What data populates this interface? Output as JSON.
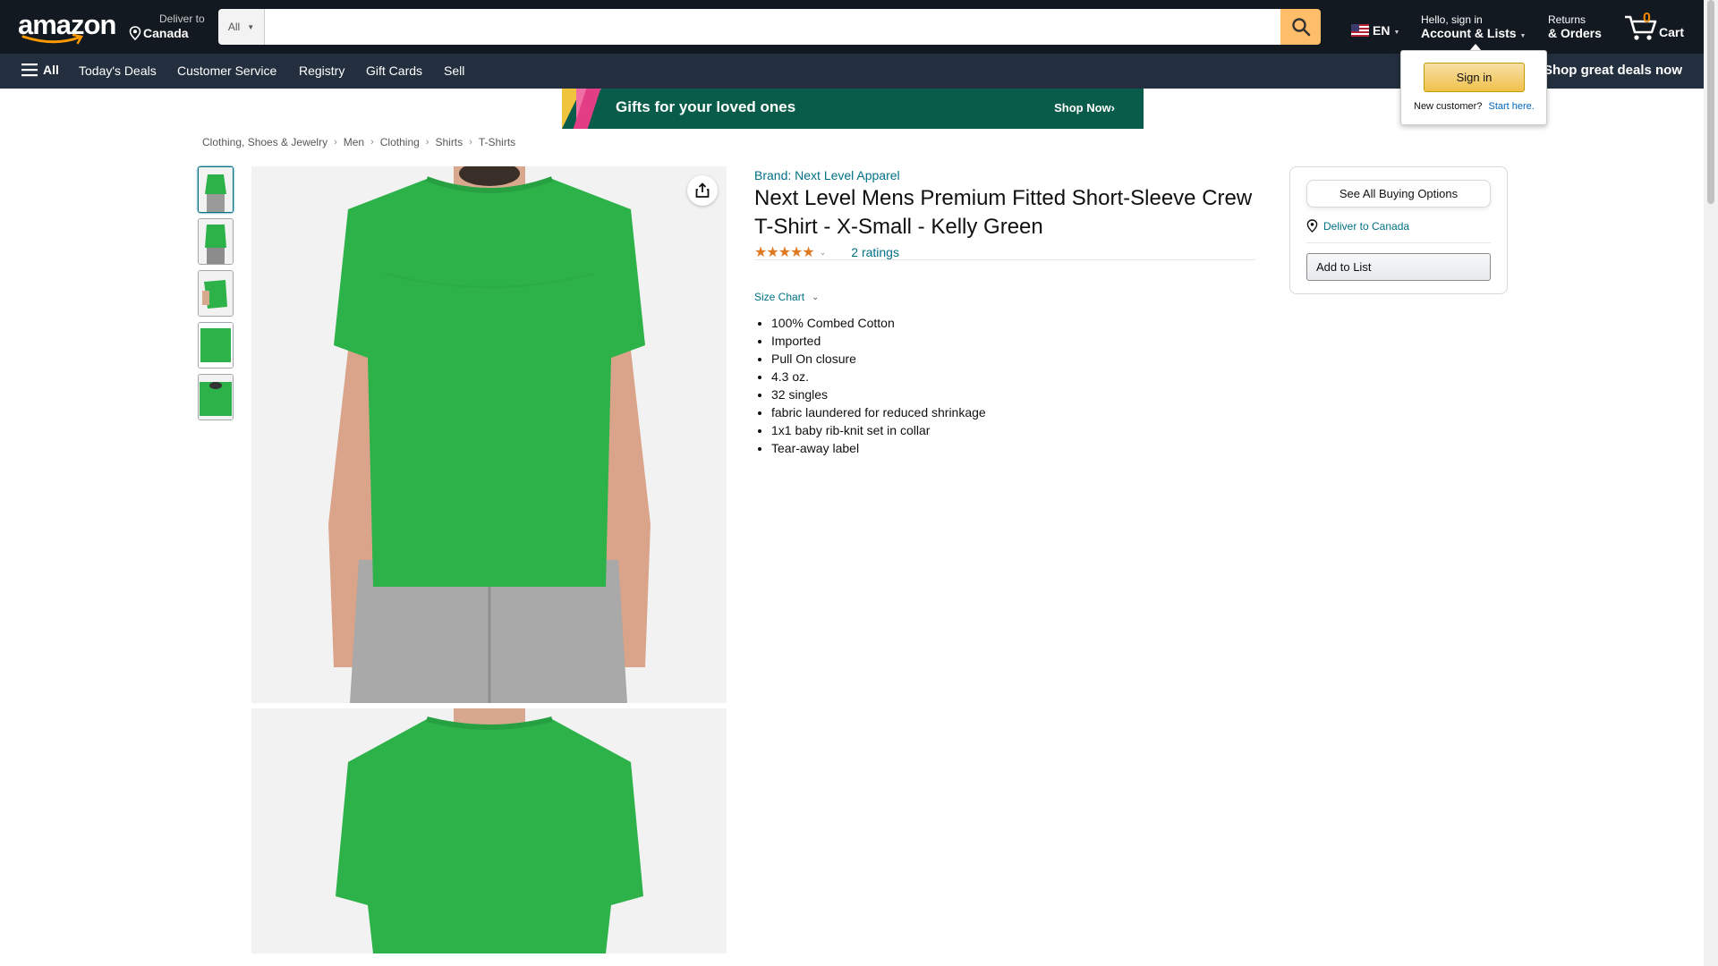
{
  "header": {
    "logo_text": "amazon",
    "deliver_line1": "Deliver to",
    "deliver_line2": "Canada",
    "search_category": "All",
    "search_placeholder": "",
    "language": "EN",
    "account_line1": "Hello, sign in",
    "account_line2": "Account & Lists",
    "orders_line1": "Returns",
    "orders_line2": "& Orders",
    "cart_count": "0",
    "cart_label": "Cart"
  },
  "nav": {
    "all_label": "All",
    "items": [
      "Today's Deals",
      "Customer Service",
      "Registry",
      "Gift Cards",
      "Sell"
    ],
    "promo": "Shop great deals now"
  },
  "signin_flyout": {
    "button": "Sign in",
    "new_customer": "New customer?",
    "start_here": "Start here."
  },
  "banner": {
    "text": "Gifts for your loved ones",
    "cta": "Shop Now›"
  },
  "breadcrumb": [
    "Clothing, Shoes & Jewelry",
    "Men",
    "Clothing",
    "Shirts",
    "T-Shirts"
  ],
  "product": {
    "brand": "Brand: Next Level Apparel",
    "title": "Next Level Mens Premium Fitted Short-Sleeve Crew T-Shirt - X-Small - Kelly Green",
    "stars": 5,
    "ratings_text": "2 ratings",
    "size_chart": "Size Chart",
    "bullets": [
      "100% Combed Cotton",
      "Imported",
      "Pull On closure",
      "4.3 oz.",
      "32 singles",
      "fabric laundered for reduced shrinkage",
      "1x1 baby rib-knit set in collar",
      "Tear-away label"
    ],
    "shirt_color": "#2db24a"
  },
  "buybox": {
    "see_all": "See All Buying Options",
    "deliver": "Deliver to Canada",
    "add_to_list": "Add to List"
  },
  "colors": {
    "nav_dark": "#131921",
    "nav_secondary": "#232f3e",
    "search_button": "#febd69",
    "link": "#007185",
    "star": "#de7921"
  }
}
